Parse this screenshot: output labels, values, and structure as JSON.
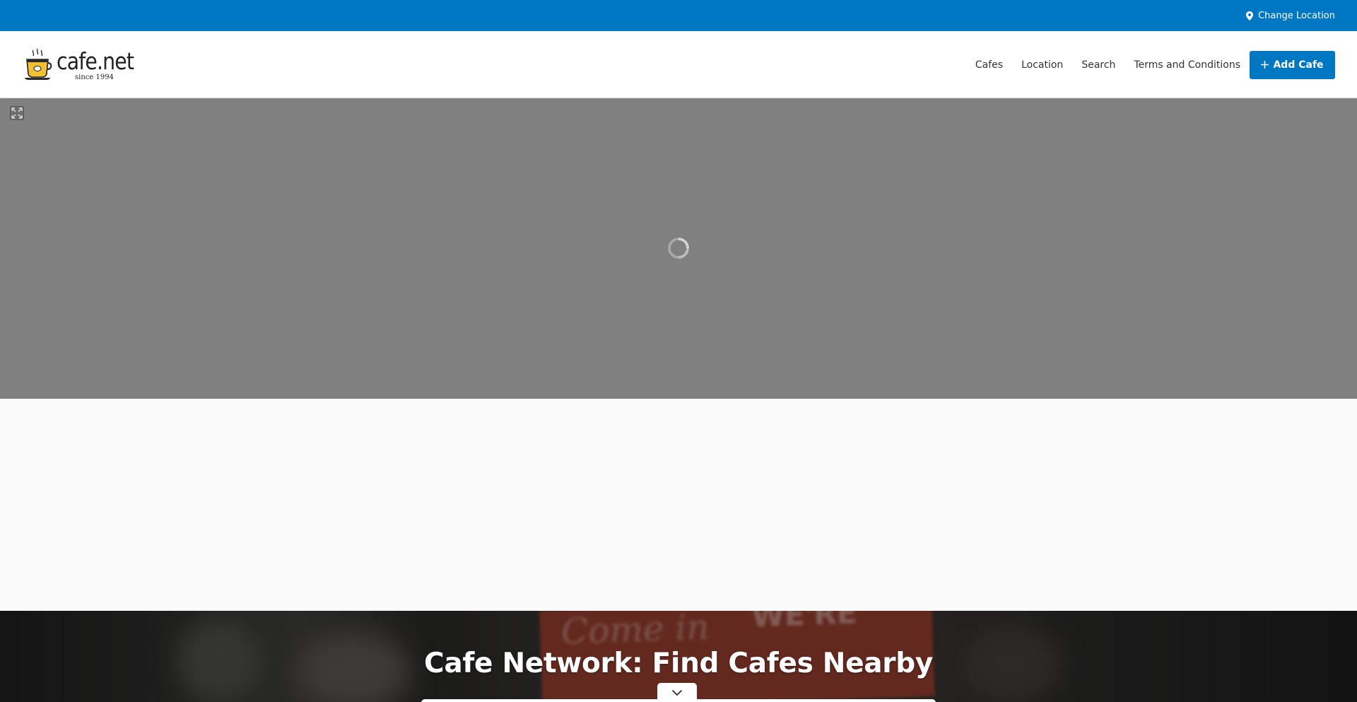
{
  "topbar": {
    "change_location_label": "Change Location",
    "location_icon": "map-pin-icon",
    "bg_color": "#0077c2"
  },
  "header": {
    "logo": {
      "name": "cafe.net",
      "tagline": "since 1994",
      "icon": "coffee-cup-icon"
    },
    "nav": {
      "items": [
        "Cafes",
        "Location",
        "Search",
        "Terms and Conditions"
      ],
      "add_button_label": "Add Cafe",
      "add_button_icon": "plus-icon"
    }
  },
  "map": {
    "fullscreen_icon": "fullscreen-icon",
    "loading_icon": "loading-spinner-icon"
  },
  "hero": {
    "title": "Cafe Network: Find Cafes Nearby",
    "toggle_icon": "chevron-down-icon"
  },
  "colors": {
    "accent": "#0077c2",
    "map_bg": "#808080"
  }
}
